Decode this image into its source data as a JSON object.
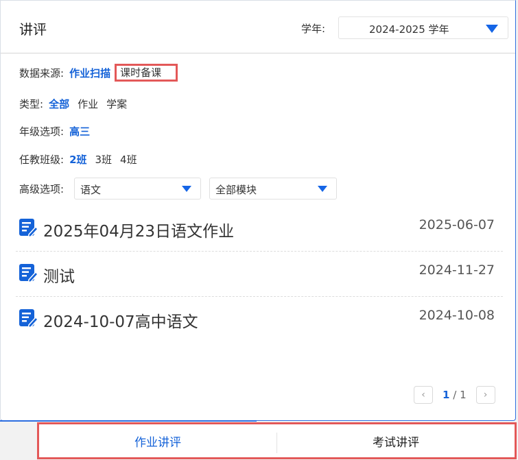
{
  "header": {
    "title": "讲评",
    "year_label": "学年:",
    "year_value": "2024-2025 学年"
  },
  "filters": {
    "source": {
      "label": "数据来源:",
      "options": [
        "作业扫描",
        "课时备课"
      ]
    },
    "type": {
      "label": "类型:",
      "options": [
        "全部",
        "作业",
        "学案"
      ]
    },
    "grade": {
      "label": "年级选项:",
      "options": [
        "高三"
      ]
    },
    "classes": {
      "label": "任教班级:",
      "options": [
        "2班",
        "3班",
        "4班"
      ]
    },
    "advanced": {
      "label": "高级选项:",
      "subject_value": "语文",
      "module_value": "全部模块"
    }
  },
  "list": [
    {
      "title": "2025年04月23日语文作业",
      "date": "2025-06-07"
    },
    {
      "title": "测试",
      "date": "2024-11-27"
    },
    {
      "title": "2024-10-07高中语文",
      "date": "2024-10-08"
    }
  ],
  "pager": {
    "current": "1",
    "separator": "/",
    "total": "1"
  },
  "tabs": [
    "作业讲评",
    "考试讲评"
  ],
  "colors": {
    "accent": "#1462d8",
    "highlight_box": "#e35858"
  }
}
